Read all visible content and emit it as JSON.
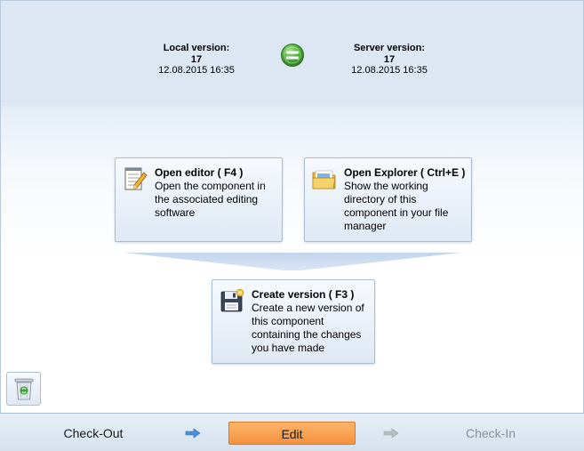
{
  "header": {
    "local": {
      "label": "Local version:",
      "version": "17",
      "date": "12.08.2015 16:35"
    },
    "server": {
      "label": "Server version:",
      "version": "17",
      "date": "12.08.2015 16:35"
    },
    "status_icon": "equal-icon",
    "status_color": "#4cae3a"
  },
  "actions": {
    "open_editor": {
      "title": "Open editor ( F4 )",
      "description": "Open the component in the associated editing software",
      "icon": "notepad-pencil-icon"
    },
    "open_explorer": {
      "title": "Open Explorer ( Ctrl+E )",
      "description": "Show the working directory of this component in your file manager",
      "icon": "folder-icon"
    },
    "create_version": {
      "title": "Create version ( F3 )",
      "description": "Create a new version of this component containing the changes you have made",
      "icon": "floppy-disk-icon"
    }
  },
  "trash": {
    "icon": "recycle-bin-icon"
  },
  "workflow": {
    "steps": [
      "Check-Out",
      "Edit",
      "Check-In"
    ],
    "active_color": "#f7a04f",
    "arrow_icon": "right-arrow-icon"
  }
}
